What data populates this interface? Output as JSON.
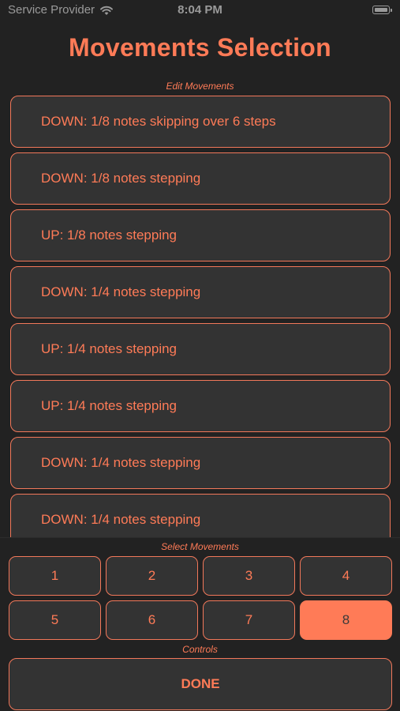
{
  "status_bar": {
    "carrier": "Service Provider",
    "time": "8:04 PM"
  },
  "title": "Movements Selection",
  "edit_section": {
    "label": "Edit Movements",
    "items": [
      "DOWN: 1/8 notes skipping over 6 steps",
      "DOWN: 1/8 notes stepping",
      "UP: 1/8 notes stepping",
      "DOWN: 1/4 notes stepping",
      "UP: 1/4 notes stepping",
      "UP: 1/4 notes stepping",
      "DOWN: 1/4 notes stepping",
      "DOWN: 1/4 notes stepping"
    ]
  },
  "select_section": {
    "label": "Select Movements",
    "buttons": [
      "1",
      "2",
      "3",
      "4",
      "5",
      "6",
      "7",
      "8"
    ],
    "selected": "8"
  },
  "controls_section": {
    "label": "Controls",
    "done_label": "DONE"
  },
  "colors": {
    "accent": "#ff7b57",
    "background": "#222222",
    "surface": "#333333"
  }
}
